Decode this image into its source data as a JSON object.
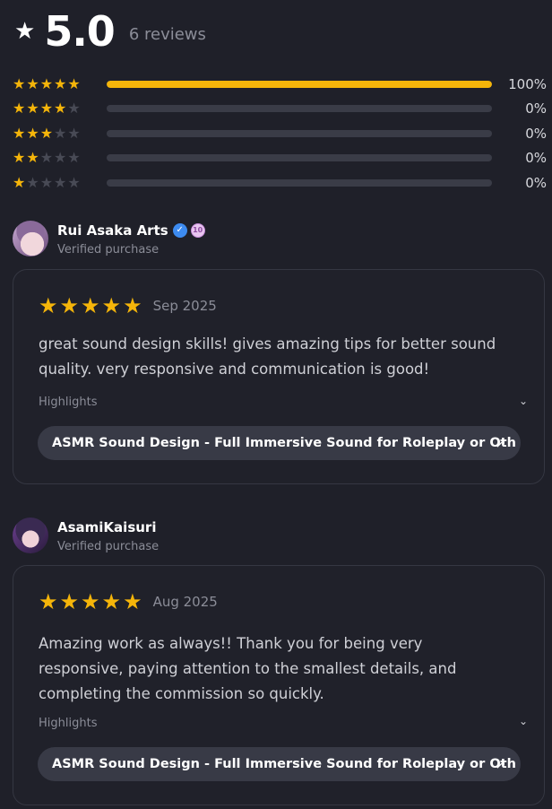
{
  "summary": {
    "score": "5.0",
    "review_count": "6 reviews"
  },
  "breakdown": [
    {
      "stars": 5,
      "percent_label": "100%",
      "fill": 1.0
    },
    {
      "stars": 4,
      "percent_label": "0%",
      "fill": 0
    },
    {
      "stars": 3,
      "percent_label": "0%",
      "fill": 0
    },
    {
      "stars": 2,
      "percent_label": "0%",
      "fill": 0
    },
    {
      "stars": 1,
      "percent_label": "0%",
      "fill": 0
    }
  ],
  "reviews": [
    {
      "name": "Rui Asaka Arts",
      "level_badge": "10",
      "subtitle": "Verified purchase",
      "rating": 5,
      "date": "Sep 2025",
      "text": "great sound design skills! gives amazing tips for better sound quality. very responsive and communication is good!",
      "highlights_label": "Highlights",
      "service_link": "ASMR Sound Design - Full Immersive Sound for Roleplay or Oth"
    },
    {
      "name": "AsamiKaisuri",
      "subtitle": "Verified purchase",
      "rating": 5,
      "date": "Aug 2025",
      "text": "Amazing work as always!! Thank you for being very responsive, paying attention to the smallest details, and completing the commission so quickly.",
      "highlights_label": "Highlights",
      "service_link": "ASMR Sound Design - Full Immersive Sound for Roleplay or Oth"
    }
  ],
  "icons": {
    "header_star": "star-icon",
    "verified": "verified-check-icon",
    "chevron": "chevron-down-icon",
    "external_link": "arrow-up-right-icon"
  },
  "colors": {
    "star_gold": "#f5b50a",
    "background": "#1f2029",
    "verified_blue": "#3d8bf0"
  }
}
